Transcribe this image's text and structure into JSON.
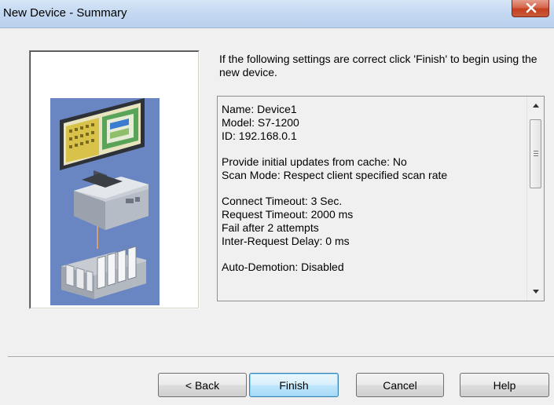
{
  "window": {
    "title": "New Device - Summary"
  },
  "intro": "If the following settings are correct click 'Finish' to begin using the new device.",
  "summary": {
    "groups": [
      [
        "Name: Device1",
        "Model: S7-1200",
        "ID: 192.168.0.1"
      ],
      [
        "Provide initial updates from cache: No",
        "Scan Mode: Respect client specified scan rate"
      ],
      [
        "Connect Timeout: 3 Sec.",
        "Request Timeout: 2000 ms",
        "Fail after 2 attempts",
        "Inter-Request Delay: 0 ms"
      ],
      [
        "Auto-Demotion: Disabled"
      ]
    ]
  },
  "buttons": {
    "back": "< Back",
    "finish": "Finish",
    "cancel": "Cancel",
    "help": "Help"
  },
  "icons": {
    "close": "close-icon",
    "illustration": "device-network-illustration"
  },
  "colors": {
    "illustration_bg": "#6a86c2",
    "close_button": "#c4401f",
    "default_button_border": "#3c7fb1"
  }
}
